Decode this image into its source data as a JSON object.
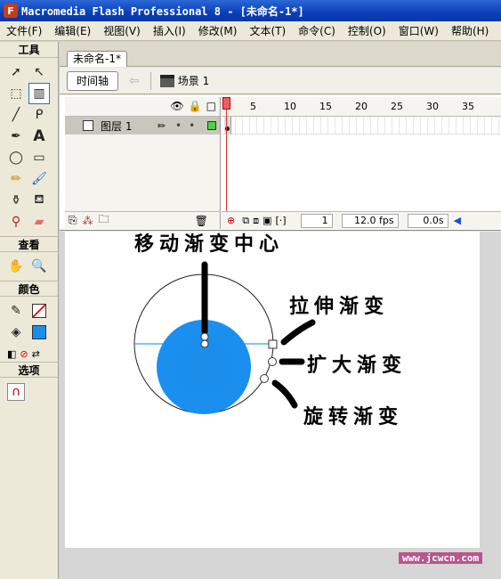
{
  "window": {
    "title": "Macromedia Flash Professional 8 - [未命名-1*]",
    "app_icon": "F"
  },
  "menu": [
    "文件(F)",
    "编辑(E)",
    "视图(V)",
    "插入(I)",
    "修改(M)",
    "文本(T)",
    "命令(C)",
    "控制(O)",
    "窗口(W)",
    "帮助(H)"
  ],
  "toolbox": {
    "tools_header": "工具",
    "view_header": "查看",
    "colors_header": "颜色",
    "options_header": "选项"
  },
  "doc": {
    "tab": "未命名-1*",
    "timeline_button": "时间轴",
    "scene": "场景 1"
  },
  "timeline": {
    "layer_name": "图层 1",
    "frame_numbers": [
      "1",
      "5",
      "10",
      "15",
      "20",
      "25",
      "30",
      "35"
    ],
    "current_frame": "1",
    "fps": "12.0 fps",
    "time": "0.0s"
  },
  "stage": {
    "fill_color": "#1a8ee8",
    "labels": {
      "move_center": "移动渐变中心",
      "stretch": "拉伸渐变",
      "scale": "扩大渐变",
      "rotate": "旋转渐变"
    },
    "watermark_url": "www.jcwcn.com"
  }
}
